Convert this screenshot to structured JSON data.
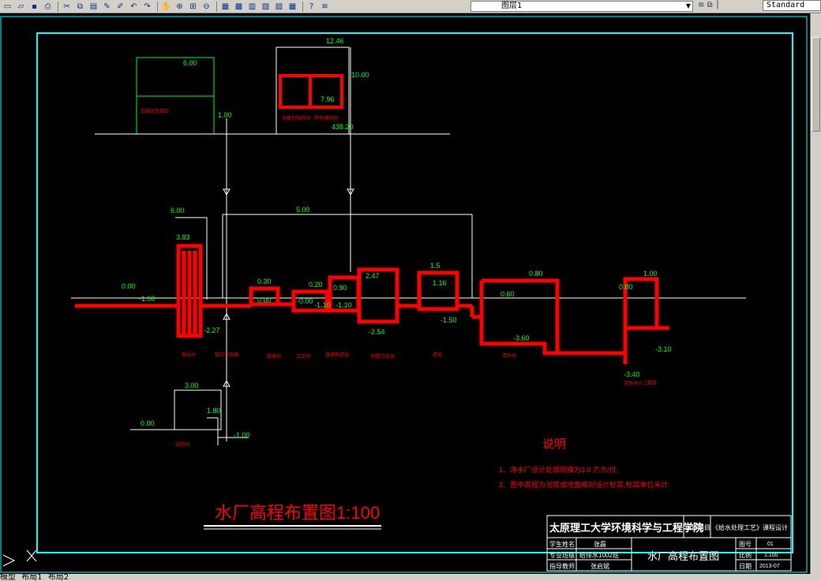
{
  "toolbar": {
    "buttons": [
      "new-icon",
      "open-icon",
      "save-icon",
      "plot-icon",
      "cut-icon",
      "copy-icon",
      "paste-icon",
      "matchprop-icon",
      "brush-icon",
      "undo-icon",
      "redo-icon",
      "pan-icon",
      "zoom-realtime-icon",
      "zoom-window-icon",
      "zoom-previous-icon",
      "properties-icon",
      "designcenter-icon",
      "toolpalettes-icon",
      "sheetset-icon",
      "markup-icon",
      "calculator-icon",
      "help-icon",
      "layer-manager-icon"
    ],
    "layer_name": "图层1",
    "text_style": "Standard"
  },
  "drawing": {
    "title": "水厂高程布置图1:100",
    "notes_heading": "说明",
    "notes": [
      "1、净水厂设计处理规模为3.0 万方/日;",
      "2、图中高程为池底或地面相对设计标高,标高单位米计."
    ],
    "elevations": [
      "12.46",
      "10.00",
      "7.96",
      "438.20",
      "6.00",
      "1.00",
      "6.00",
      "5.00",
      "3.83",
      "0.00",
      "-1.00",
      "-2.27",
      "0.30",
      "0.00",
      "0.20",
      "-0.00",
      "-1.10",
      "0.90",
      "-1.10",
      "2.47",
      "-2.54",
      "1.5",
      "1.16",
      "-1.50",
      "0.80",
      "0.60",
      "-3.60",
      "1.00",
      "0.80",
      "-3.10",
      "-3.40",
      "3.00",
      "1.80",
      "0.00",
      "-1.00"
    ],
    "units": [
      "加氯间及氯库",
      "消毒剂加药间",
      "加药间",
      "取水井",
      "管式混合器",
      "絮凝池",
      "沉淀池",
      "普通快滤池",
      "斜管沉淀池",
      "滤池",
      "清水池",
      "送水井十二泵房",
      "加药间"
    ],
    "units_top": [
      "消毒剂加药间",
      "药剂储药间"
    ]
  },
  "titleblock": {
    "school": "太原理工大学环境科学与工程学院",
    "project_label": "设计题目",
    "project": "《给水处理工艺》课程设计",
    "student_label": "学生姓名",
    "student": "张磊",
    "class_label": "专业班级",
    "class": "给排水1002班",
    "advisor_label": "指导教师",
    "advisor": "张启斌",
    "drawing_name": "水厂高程布置图",
    "sheet_label": "图号",
    "sheet": "01",
    "scale_label": "比例",
    "scale": "1:100",
    "date_label": "日期",
    "date": "2013-07"
  },
  "tabs": [
    "模型",
    "布局1",
    "布局2"
  ],
  "colors": {
    "red": "#ff0000",
    "green": "#00ff00",
    "white": "#ffffff",
    "cyan": "#00ffff",
    "background": "#000000"
  }
}
